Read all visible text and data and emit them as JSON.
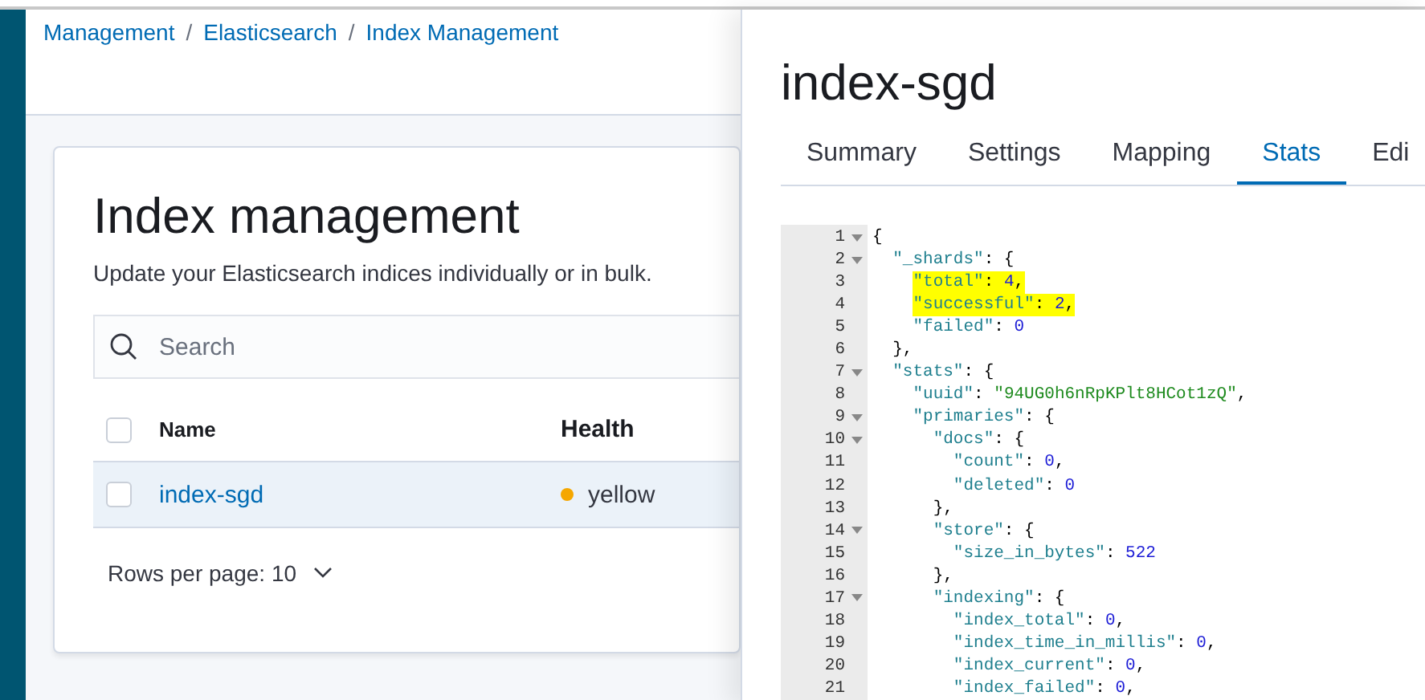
{
  "breadcrumb_separator": "/",
  "breadcrumbs": [
    {
      "label": "Management"
    },
    {
      "label": "Elasticsearch"
    },
    {
      "label": "Index Management"
    }
  ],
  "page": {
    "title": "Index management",
    "subtitle": "Update your Elasticsearch indices individually or in bulk.",
    "search": {
      "placeholder": "Search"
    },
    "table": {
      "select_all": {
        "checked": false
      },
      "columns": [
        "Name",
        "Health"
      ],
      "rows": [
        {
          "checked": false,
          "name": "index-sgd",
          "health": "yellow",
          "color": "#f5a700"
        }
      ]
    },
    "pagination": {
      "rows_per_page": "Rows per page: 10"
    }
  },
  "flyout": {
    "title": "index-sgd",
    "tabs": [
      {
        "label": "Summary",
        "selected": false
      },
      {
        "label": "Settings",
        "selected": false
      },
      {
        "label": "Mapping",
        "selected": false
      },
      {
        "label": "Stats",
        "selected": true
      },
      {
        "label": "Edi",
        "selected": false
      }
    ],
    "code": [
      {
        "number": "1",
        "text": "{",
        "foldable": true,
        "highlighted": false
      },
      {
        "number": "2",
        "text": "  \"_shards\": {",
        "foldable": true,
        "highlighted": false
      },
      {
        "number": "3",
        "text": "    \"total\": 4,",
        "foldable": false,
        "highlighted": true
      },
      {
        "number": "4",
        "text": "    \"successful\": 2,",
        "foldable": false,
        "highlighted": true
      },
      {
        "number": "5",
        "text": "    \"failed\": 0",
        "foldable": false,
        "highlighted": false
      },
      {
        "number": "6",
        "text": "  },",
        "foldable": false,
        "highlighted": false
      },
      {
        "number": "7",
        "text": "  \"stats\": {",
        "foldable": true,
        "highlighted": false
      },
      {
        "number": "8",
        "text": "    \"uuid\": \"94UG0h6nRpKPlt8HCot1zQ\",",
        "foldable": false,
        "highlighted": false
      },
      {
        "number": "9",
        "text": "    \"primaries\": {",
        "foldable": true,
        "highlighted": false
      },
      {
        "number": "10",
        "text": "      \"docs\": {",
        "foldable": true,
        "highlighted": false
      },
      {
        "number": "11",
        "text": "        \"count\": 0,",
        "foldable": false,
        "highlighted": false
      },
      {
        "number": "12",
        "text": "        \"deleted\": 0",
        "foldable": false,
        "highlighted": false
      },
      {
        "number": "13",
        "text": "      },",
        "foldable": false,
        "highlighted": false
      },
      {
        "number": "14",
        "text": "      \"store\": {",
        "foldable": true,
        "highlighted": false
      },
      {
        "number": "15",
        "text": "        \"size_in_bytes\": 522",
        "foldable": false,
        "highlighted": false
      },
      {
        "number": "16",
        "text": "      },",
        "foldable": false,
        "highlighted": false
      },
      {
        "number": "17",
        "text": "      \"indexing\": {",
        "foldable": true,
        "highlighted": false
      },
      {
        "number": "18",
        "text": "        \"index_total\": 0,",
        "foldable": false,
        "highlighted": false
      },
      {
        "number": "19",
        "text": "        \"index_time_in_millis\": 0,",
        "foldable": false,
        "highlighted": false
      },
      {
        "number": "20",
        "text": "        \"index_current\": 0,",
        "foldable": false,
        "highlighted": false
      },
      {
        "number": "21",
        "text": "        \"index_failed\": 0,",
        "foldable": false,
        "highlighted": false
      }
    ]
  }
}
